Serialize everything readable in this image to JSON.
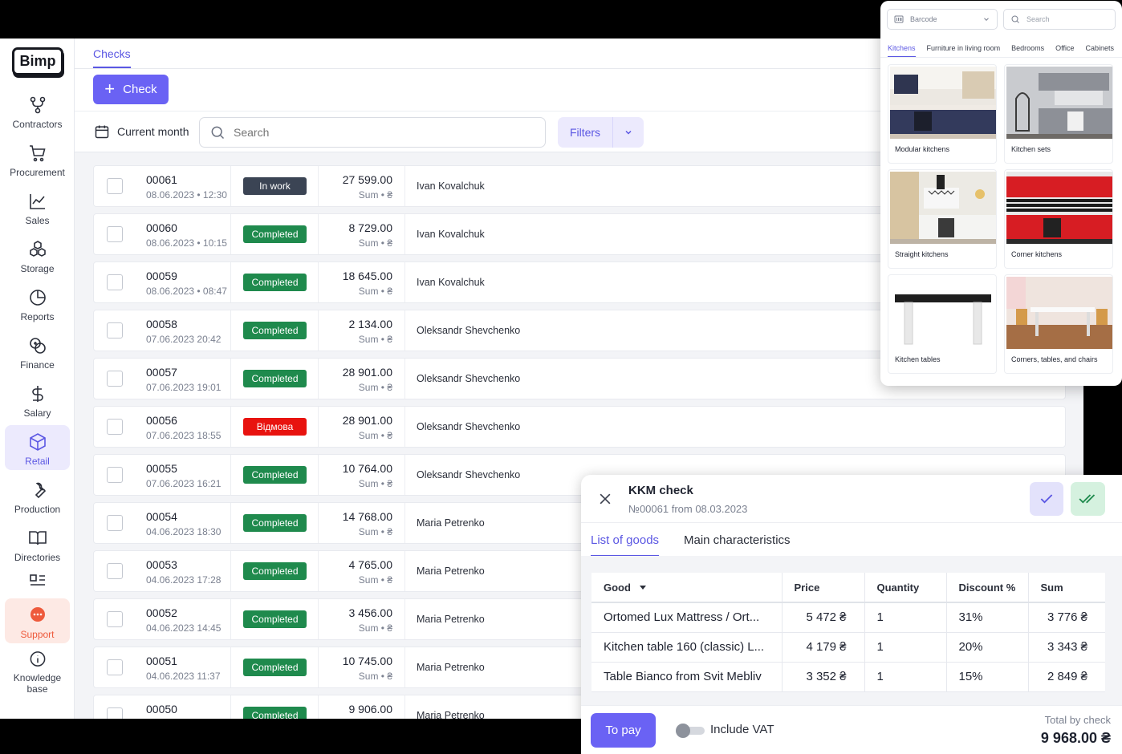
{
  "app": {
    "logo": "Bimp"
  },
  "sidebar": {
    "items": [
      {
        "label": "Contractors"
      },
      {
        "label": "Procurement"
      },
      {
        "label": "Sales"
      },
      {
        "label": "Storage"
      },
      {
        "label": "Reports"
      },
      {
        "label": "Finance"
      },
      {
        "label": "Salary"
      },
      {
        "label": "Retail"
      },
      {
        "label": "Production"
      },
      {
        "label": "Directories"
      },
      {
        "label": "Support"
      },
      {
        "label": "Knowledge base"
      }
    ]
  },
  "page": {
    "tab": "Checks",
    "add_button": "Check",
    "period": "Current month",
    "search_placeholder": "Search",
    "filters": "Filters"
  },
  "checks": [
    {
      "number": "00061",
      "date": "08.06.2023 • 12:30",
      "status": "In work",
      "status_type": "work",
      "sum": "27 599.00",
      "sum_label": "Sum • ₴",
      "contractor": "Ivan Kovalchuk"
    },
    {
      "number": "00060",
      "date": "08.06.2023 • 10:15",
      "status": "Completed",
      "status_type": "done",
      "sum": "8 729.00",
      "sum_label": "Sum • ₴",
      "contractor": "Ivan Kovalchuk"
    },
    {
      "number": "00059",
      "date": "08.06.2023 • 08:47",
      "status": "Completed",
      "status_type": "done",
      "sum": "18 645.00",
      "sum_label": "Sum • ₴",
      "contractor": "Ivan Kovalchuk"
    },
    {
      "number": "00058",
      "date": "07.06.2023 20:42",
      "status": "Completed",
      "status_type": "done",
      "sum": "2 134.00",
      "sum_label": "Sum • ₴",
      "contractor": "Oleksandr Shevchenko"
    },
    {
      "number": "00057",
      "date": "07.06.2023 19:01",
      "status": "Completed",
      "status_type": "done",
      "sum": "28 901.00",
      "sum_label": "Sum • ₴",
      "contractor": "Oleksandr Shevchenko"
    },
    {
      "number": "00056",
      "date": "07.06.2023 18:55",
      "status": "Відмова",
      "status_type": "cancel",
      "sum": "28 901.00",
      "sum_label": "Sum • ₴",
      "contractor": "Oleksandr Shevchenko"
    },
    {
      "number": "00055",
      "date": "07.06.2023 16:21",
      "status": "Completed",
      "status_type": "done",
      "sum": "10 764.00",
      "sum_label": "Sum • ₴",
      "contractor": "Oleksandr Shevchenko"
    },
    {
      "number": "00054",
      "date": "04.06.2023 18:30",
      "status": "Completed",
      "status_type": "done",
      "sum": "14 768.00",
      "sum_label": "Sum • ₴",
      "contractor": "Maria Petrenko"
    },
    {
      "number": "00053",
      "date": "04.06.2023 17:28",
      "status": "Completed",
      "status_type": "done",
      "sum": "4 765.00",
      "sum_label": "Sum • ₴",
      "contractor": "Maria Petrenko"
    },
    {
      "number": "00052",
      "date": "04.06.2023 14:45",
      "status": "Completed",
      "status_type": "done",
      "sum": "3 456.00",
      "sum_label": "Sum • ₴",
      "contractor": "Maria Petrenko"
    },
    {
      "number": "00051",
      "date": "04.06.2023 11:37",
      "status": "Completed",
      "status_type": "done",
      "sum": "10 745.00",
      "sum_label": "Sum • ₴",
      "contractor": "Maria Petrenko"
    },
    {
      "number": "00050",
      "date": "",
      "status": "Completed",
      "status_type": "done",
      "sum": "9 906.00",
      "sum_label": "",
      "contractor": "Maria Petrenko"
    }
  ],
  "catalog": {
    "barcode": "Barcode",
    "search_placeholder": "Search",
    "tabs": [
      "Kitchens",
      "Furniture in living room",
      "Bedrooms",
      "Office",
      "Cabinets"
    ],
    "cards": [
      {
        "caption": "Modular kitchens"
      },
      {
        "caption": "Kitchen sets"
      },
      {
        "caption": "Straight kitchens"
      },
      {
        "caption": "Corner kitchens"
      },
      {
        "caption": "Kitchen tables"
      },
      {
        "caption": "Corners, tables, and chairs"
      }
    ]
  },
  "kkm": {
    "title": "KKM check",
    "subtitle": "№00061 from 08.03.2023",
    "tabs": {
      "goods": "List of goods",
      "main": "Main characteristics"
    },
    "columns": {
      "good": "Good",
      "price": "Price",
      "quantity": "Quantity",
      "discount": "Discount %",
      "sum": "Sum"
    },
    "goods": [
      {
        "name": "Ortomed Lux Mattress / Ort...",
        "price": "5 472 ₴",
        "qty": "1",
        "discount": "31%",
        "sum": "3 776 ₴"
      },
      {
        "name": "Kitchen table 160 (classic) L...",
        "price": "4 179 ₴",
        "qty": "1",
        "discount": "20%",
        "sum": "3 343 ₴"
      },
      {
        "name": "Table Bianco from Svit Mebliv",
        "price": "3 352 ₴",
        "qty": "1",
        "discount": "15%",
        "sum": "2 849 ₴"
      }
    ],
    "pay_button": "To pay",
    "vat_label": "Include VAT",
    "total_label": "Total by check",
    "total_value": "9 968.00 ₴"
  },
  "colors": {
    "accent": "#6a62f4",
    "completed": "#1f8a4d",
    "in_work": "#3b4454",
    "rejected": "#e8130f",
    "support": "#ee5a3c"
  }
}
